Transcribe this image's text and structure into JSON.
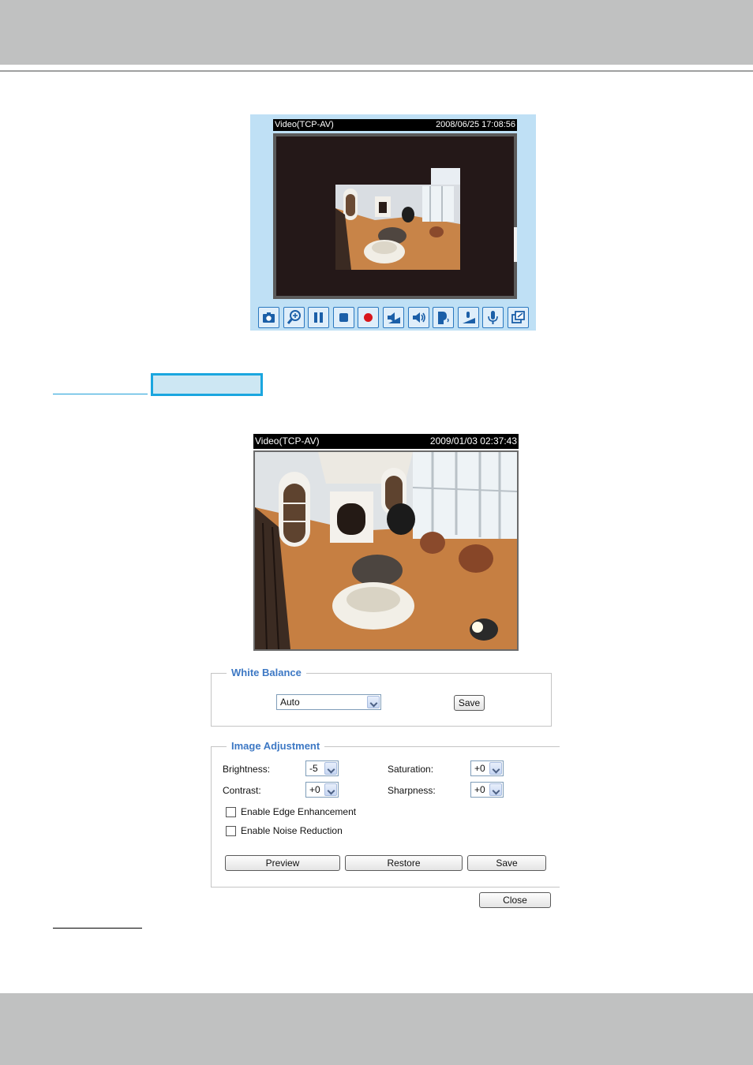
{
  "viewer_top": {
    "stream_label": "Video(TCP-AV)",
    "timestamp": "2008/06/25 17:08:56",
    "toolbar": [
      {
        "name": "snapshot-icon"
      },
      {
        "name": "digital-zoom-icon"
      },
      {
        "name": "pause-icon"
      },
      {
        "name": "stop-icon"
      },
      {
        "name": "record-icon"
      },
      {
        "name": "volume-icon"
      },
      {
        "name": "mute-icon"
      },
      {
        "name": "talk-icon"
      },
      {
        "name": "mic-volume-icon"
      },
      {
        "name": "microphone-icon"
      },
      {
        "name": "fullscreen-icon"
      }
    ]
  },
  "viewer_bottom": {
    "stream_label": "Video(TCP-AV)",
    "timestamp": "2009/01/03 02:37:43"
  },
  "white_balance": {
    "legend": "White Balance",
    "mode_value": "Auto",
    "save_label": "Save"
  },
  "image_adjustment": {
    "legend": "Image Adjustment",
    "brightness_label": "Brightness:",
    "brightness_value": "-5",
    "saturation_label": "Saturation:",
    "saturation_value": "+0",
    "contrast_label": "Contrast:",
    "contrast_value": "+0",
    "sharpness_label": "Sharpness:",
    "sharpness_value": "+0",
    "edge_label": "Enable Edge Enhancement",
    "noise_label": "Enable Noise Reduction",
    "preview_label": "Preview",
    "restore_label": "Restore",
    "save_label": "Save"
  },
  "close_label": "Close",
  "colors": {
    "accent_blue": "#3d78c4",
    "viewer_bg": "#bfe0f5",
    "band_gray": "#c0c1c1"
  }
}
